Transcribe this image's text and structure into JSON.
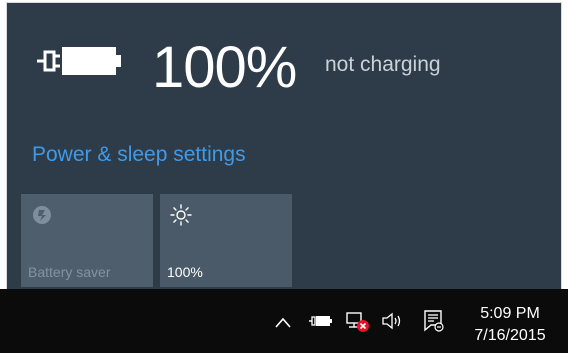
{
  "battery": {
    "percent": "100%",
    "status": "not charging",
    "settings_link": "Power & sleep settings"
  },
  "tiles": [
    {
      "label": "Battery saver",
      "icon": "battery-saver-icon",
      "enabled": false
    },
    {
      "label": "100%",
      "icon": "brightness-icon",
      "enabled": true
    }
  ],
  "taskbar": {
    "icons": [
      "chevron-up-icon",
      "battery-icon",
      "network-disconnected-icon",
      "volume-icon",
      "action-center-icon"
    ],
    "time": "5:09 PM",
    "date": "7/16/2015"
  },
  "colors": {
    "flyout_bg": "#2e3c4a",
    "accent_link": "#3f9ae8",
    "taskbar_bg": "#0b0b0b",
    "error_red": "#e81123"
  }
}
